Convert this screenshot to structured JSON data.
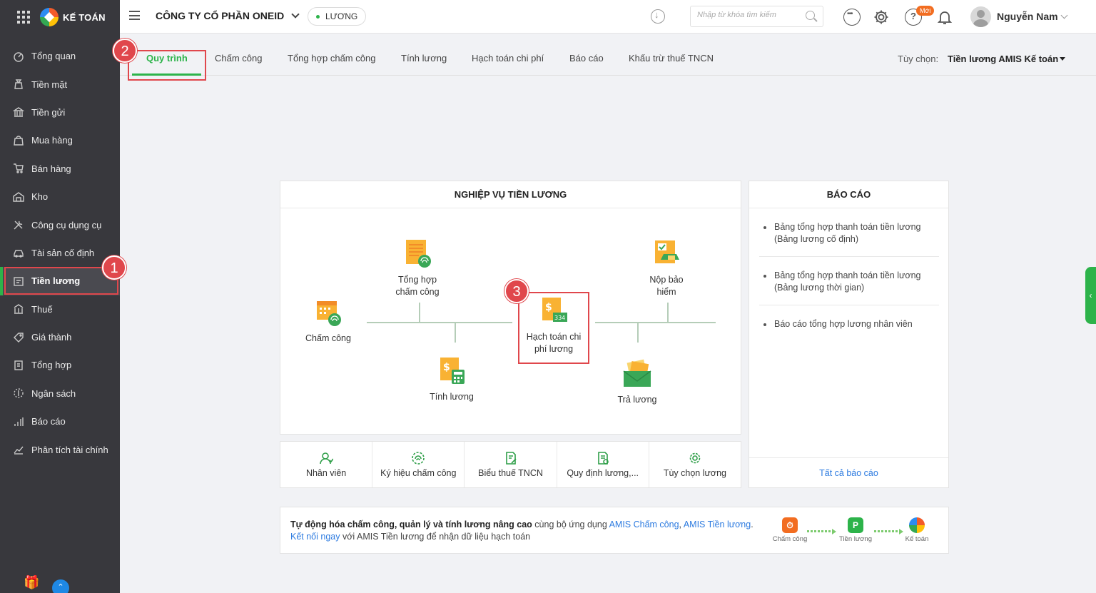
{
  "brand": {
    "name": "KẾ TOÁN"
  },
  "sidebar": {
    "items": [
      {
        "label": "Tổng quan"
      },
      {
        "label": "Tiền mặt"
      },
      {
        "label": "Tiền gửi"
      },
      {
        "label": "Mua hàng"
      },
      {
        "label": "Bán hàng"
      },
      {
        "label": "Kho"
      },
      {
        "label": "Công cụ dụng cụ"
      },
      {
        "label": "Tài sản cố định"
      },
      {
        "label": "Tiền lương"
      },
      {
        "label": "Thuế"
      },
      {
        "label": "Giá thành"
      },
      {
        "label": "Tổng hợp"
      },
      {
        "label": "Ngân sách"
      },
      {
        "label": "Báo cáo"
      },
      {
        "label": "Phân tích tài chính"
      }
    ],
    "active_index": 8
  },
  "header": {
    "company": "CÔNG TY CỔ PHẦN ONEID",
    "module": "LƯƠNG",
    "search_placeholder": "Nhập từ khóa tìm kiếm",
    "new_badge": "Mới",
    "help_glyph": "?",
    "user_name": "Nguyễn Nam"
  },
  "tabs": [
    {
      "label": "Quy trình"
    },
    {
      "label": "Chấm công"
    },
    {
      "label": "Tổng hợp chấm công"
    },
    {
      "label": "Tính lương"
    },
    {
      "label": "Hạch toán chi phí"
    },
    {
      "label": "Báo cáo"
    },
    {
      "label": "Khấu trừ thuế TNCN"
    }
  ],
  "options": {
    "label": "Tùy chọn:",
    "value": "Tiền lương AMIS Kế toán"
  },
  "steps": {
    "one": "1",
    "two": "2",
    "three": "3"
  },
  "process": {
    "title": "NGHIỆP VỤ TIỀN LƯƠNG",
    "items": {
      "timesheet": "Chấm công",
      "timesheet_summary": "Tổng hợp chấm công",
      "payroll": "Tính lương",
      "cost_accounting": "Hạch toán chi phí lương",
      "insurance": "Nộp bảo hiểm",
      "pay": "Trả lương"
    },
    "cost_code": "334"
  },
  "reports": {
    "title": "BÁO CÁO",
    "items": [
      "Bảng tổng hợp thanh toán tiền lương (Bảng lương cố định)",
      "Bảng tổng hợp thanh toán tiền lương (Bảng lương thời gian)",
      "Báo cáo tổng hợp lương nhân viên"
    ],
    "all_link": "Tất cả báo cáo"
  },
  "shortcuts": [
    {
      "label": "Nhân viên"
    },
    {
      "label": "Ký hiệu chấm công"
    },
    {
      "label": "Biểu thuế TNCN"
    },
    {
      "label": "Quy định lương,..."
    },
    {
      "label": "Tùy chọn lương"
    }
  ],
  "promo": {
    "bold": "Tự động hóa chấm công, quản lý và tính lương nâng cao",
    "text1": " cùng bộ ứng dụng ",
    "link1": "AMIS Chấm công",
    "sep": ", ",
    "link2": "AMIS Tiền lương",
    "dot": ".",
    "link3": "Kết nối ngay",
    "text2": " với AMIS Tiền lương để nhận dữ liệu hạch toán",
    "apps": [
      "Chấm công",
      "Tiền lương",
      "Kế toán"
    ]
  },
  "colors": {
    "accent": "#2db34a",
    "highlight": "#e0474c",
    "sidebar": "#38383d",
    "link": "#2d7be0"
  }
}
